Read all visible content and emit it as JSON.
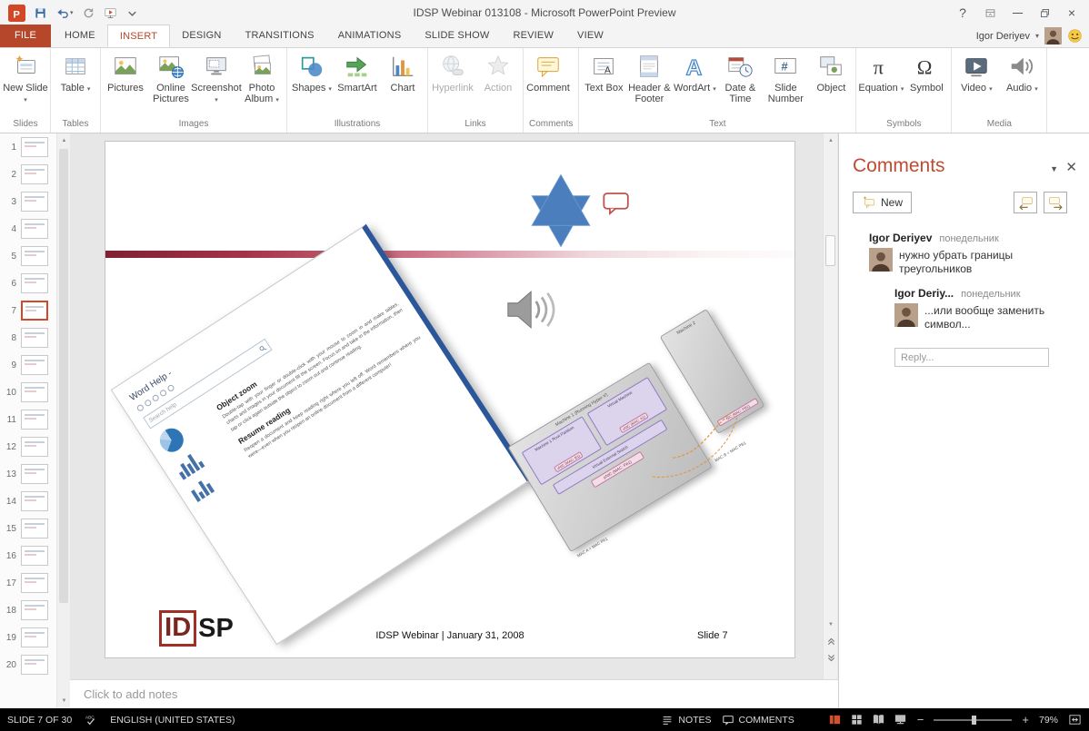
{
  "colors": {
    "accent": "#B7472A",
    "logo_orange": "#D24726",
    "star_blue": "#4A7EBD",
    "statusbar_bg": "#000000"
  },
  "titlebar": {
    "title": "IDSP Webinar 013108 - Microsoft PowerPoint Preview",
    "quick_access": [
      {
        "name": "save-icon",
        "label": "Save"
      },
      {
        "name": "undo-icon",
        "label": "Undo",
        "arrow": true
      },
      {
        "name": "repeat-icon",
        "label": "Repeat"
      },
      {
        "name": "start-slideshow-icon",
        "label": "Start From Beginning"
      },
      {
        "name": "customize-qat-icon",
        "label": "Customize Quick Access Toolbar"
      }
    ]
  },
  "ribbon": {
    "tabs": [
      "FILE",
      "HOME",
      "INSERT",
      "DESIGN",
      "TRANSITIONS",
      "ANIMATIONS",
      "SLIDE SHOW",
      "REVIEW",
      "VIEW"
    ],
    "active_tab": "INSERT",
    "user_name": "Igor Deriyev",
    "groups": [
      {
        "label": "Slides",
        "buttons": [
          {
            "label": "New Slide",
            "icon": "new-slide-icon",
            "arrow": true
          }
        ]
      },
      {
        "label": "Tables",
        "buttons": [
          {
            "label": "Table",
            "icon": "table-icon",
            "arrow": true
          }
        ]
      },
      {
        "label": "Images",
        "buttons": [
          {
            "label": "Pictures",
            "icon": "pictures-icon"
          },
          {
            "label": "Online Pictures",
            "icon": "online-pictures-icon"
          },
          {
            "label": "Screenshot",
            "icon": "screenshot-icon",
            "arrow": true
          },
          {
            "label": "Photo Album",
            "icon": "photo-album-icon",
            "arrow": true
          }
        ]
      },
      {
        "label": "Illustrations",
        "buttons": [
          {
            "label": "Shapes",
            "icon": "shapes-icon",
            "arrow": true
          },
          {
            "label": "SmartArt",
            "icon": "smartart-icon"
          },
          {
            "label": "Chart",
            "icon": "chart-icon"
          }
        ]
      },
      {
        "label": "Links",
        "buttons": [
          {
            "label": "Hyperlink",
            "icon": "hyperlink-icon",
            "disabled": true
          },
          {
            "label": "Action",
            "icon": "action-icon",
            "disabled": true
          }
        ]
      },
      {
        "label": "Comments",
        "buttons": [
          {
            "label": "Comment",
            "icon": "new-comment-icon"
          }
        ]
      },
      {
        "label": "Text",
        "buttons": [
          {
            "label": "Text Box",
            "icon": "text-box-icon"
          },
          {
            "label": "Header & Footer",
            "icon": "header-footer-icon"
          },
          {
            "label": "WordArt",
            "icon": "wordart-icon",
            "arrow": true
          },
          {
            "label": "Date & Time",
            "icon": "date-time-icon"
          },
          {
            "label": "Slide Number",
            "icon": "slide-number-icon"
          },
          {
            "label": "Object",
            "icon": "object-icon"
          }
        ]
      },
      {
        "label": "Symbols",
        "buttons": [
          {
            "label": "Equation",
            "icon": "equation-icon",
            "arrow": true
          },
          {
            "label": "Symbol",
            "icon": "symbol-icon"
          }
        ]
      },
      {
        "label": "Media",
        "buttons": [
          {
            "label": "Video",
            "icon": "video-icon",
            "arrow": true
          },
          {
            "label": "Audio",
            "icon": "audio-icon",
            "arrow": true
          }
        ]
      }
    ]
  },
  "thumbnails": {
    "numbers": [
      1,
      2,
      3,
      4,
      5,
      6,
      7,
      8,
      9,
      10,
      11,
      12,
      13,
      14,
      15,
      16,
      17,
      18,
      19,
      20
    ],
    "selected": 7
  },
  "slide": {
    "footer_text": "IDSP Webinar | January 31, 2008",
    "slide_number_text": "Slide 7",
    "logo": {
      "id": "ID",
      "sp": "SP"
    },
    "word_help_doc": {
      "title": "Word Help -",
      "search_placeholder": "Search help",
      "sections": [
        {
          "heading": "Object zoom",
          "body": "Double-tap with your finger or double-click with your mouse to zoom in and make tables, charts and images in your document fill the screen. Focus on and take in the information, then tap or click again outside the object to zoom out and continue reading."
        },
        {
          "heading": "Resume reading",
          "body": "Reopen a document and keep reading right where you left off. Word remembers where you were—even when you reopen an online document from a different computer!"
        }
      ]
    },
    "diagram": {
      "machine1_label": "Machine 1 (Running Hyper-V)",
      "machine2_label": "Machine 2",
      "vm1_label": "Machine 1 Root Partition",
      "vm2_label": "Virtual Machine",
      "vnic_b": "vNIC (MAC: B1)",
      "vnic_a": "vNIC (MAC: A1)",
      "switch_label": "Virtual External Switch",
      "pnic_label": "pNIC (MAC: PA1)",
      "nic_label": "NIC (MAC: PB1)",
      "note1": "MAC A = MAC PA1",
      "note2": "MAC B = MAC PB1"
    }
  },
  "notes": {
    "placeholder": "Click to add notes"
  },
  "comments_panel": {
    "title": "Comments",
    "new_button_label": "New",
    "reply_placeholder": "Reply...",
    "comments": [
      {
        "author": "Igor Deriyev",
        "date": "понедельник",
        "text": "нужно убрать границы треугольников",
        "indent": 0
      },
      {
        "author": "Igor Deriy...",
        "date": "понедельник",
        "text": "...или вообще заменить символ...",
        "indent": 1
      }
    ]
  },
  "statusbar": {
    "slide_info": "SLIDE 7 OF 30",
    "language": "ENGLISH (UNITED STATES)",
    "notes_label": "NOTES",
    "comments_label": "COMMENTS",
    "zoom_percent": "79%"
  }
}
